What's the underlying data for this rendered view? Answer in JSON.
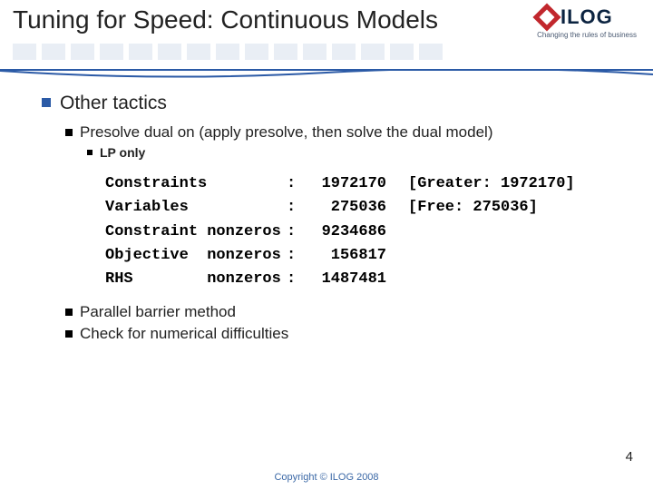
{
  "title": "Tuning for Speed: Continuous Models",
  "logo": {
    "letters": "ILOG",
    "tagline": "Changing the rules of business"
  },
  "section_heading": "Other tactics",
  "sub_bullets_top": [
    "Presolve dual on (apply presolve, then solve the dual model)"
  ],
  "sub_sub_bullet": "LP only",
  "stats": [
    {
      "label": "Constraints",
      "sep": ":",
      "value": "1972170",
      "extra": "[Greater: 1972170]"
    },
    {
      "label": "Variables",
      "sep": ":",
      "value": "275036",
      "extra": "[Free: 275036]"
    },
    {
      "label": "Constraint nonzeros",
      "sep": ":",
      "value": "9234686",
      "extra": ""
    },
    {
      "label": "Objective  nonzeros",
      "sep": ":",
      "value": "156817",
      "extra": ""
    },
    {
      "label": "RHS        nonzeros",
      "sep": ":",
      "value": "1487481",
      "extra": ""
    }
  ],
  "sub_bullets_bottom": [
    "Parallel barrier method",
    "Check for numerical difficulties"
  ],
  "footer": "Copyright © ILOG 2008",
  "page_number": "4"
}
